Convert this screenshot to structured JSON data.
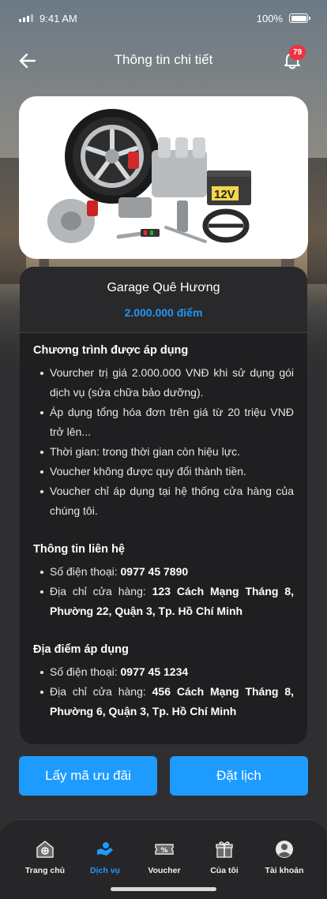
{
  "status_bar": {
    "time": "9:41 AM",
    "battery": "100%"
  },
  "header": {
    "title": "Thông tin chi tiết",
    "notification_count": "79"
  },
  "detail": {
    "shop_name": "Garage Quê Hương",
    "points": "2.000.000 điểm",
    "program": {
      "title": "Chương trình được áp dụng",
      "items": [
        "Vourcher trị giá 2.000.000 VNĐ khi sử dụng gói dịch vụ (sửa chữa bảo dưỡng).",
        "Áp dụng tổng hóa đơn trên giá từ 20 triệu VNĐ trở lên...",
        "Thời gian: trong thời gian còn hiệu lực.",
        "Voucher không được quy đổi thành tiền.",
        "Voucher chỉ áp dụng tại hệ thống cửa hàng của chúng tôi."
      ]
    },
    "contact": {
      "title": "Thông tin liên hệ",
      "phone_label": "Số điện thoại: ",
      "phone": "0977 45 7890",
      "address_label": "Địa chỉ cửa hàng: ",
      "address": "123 Cách Mạng Tháng 8, Phường 22, Quận 3, Tp. Hồ Chí Minh"
    },
    "location": {
      "title": "Địa điểm áp dụng",
      "phone_label": "Số điện thoại: ",
      "phone": "0977 45 1234",
      "address_label": "Địa chỉ cửa hàng: ",
      "address": "456 Cách Mạng Tháng 8, Phường 6, Quận 3, Tp. Hồ Chí Minh"
    }
  },
  "actions": {
    "get_code": "Lấy mã ưu đãi",
    "book": "Đặt lịch"
  },
  "image": {
    "battery_label": "12V"
  },
  "nav": [
    {
      "label": "Trang chủ",
      "icon": "home-icon"
    },
    {
      "label": "Dịch vụ",
      "icon": "service-hand-icon",
      "active": true
    },
    {
      "label": "Voucher",
      "icon": "voucher-icon"
    },
    {
      "label": "Của tôi",
      "icon": "gift-icon"
    },
    {
      "label": "Tài khoản",
      "icon": "user-icon"
    }
  ],
  "colors": {
    "accent": "#1e9bff",
    "badge": "#ef3340",
    "card": "#1f1f21"
  }
}
